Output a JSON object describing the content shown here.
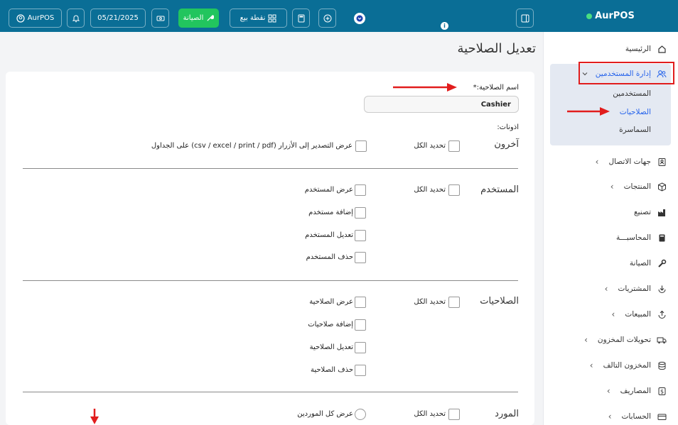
{
  "topbar": {
    "brand": "AurPOS",
    "user_label": "AurPOS",
    "date": "05/21/2025",
    "maintenance_label": "الصيانة",
    "pos_label": "نقطة بيع"
  },
  "sidebar": {
    "items": [
      {
        "label": "الرئيسية"
      },
      {
        "label": "إدارة المستخدمين"
      },
      {
        "label": "جهات الاتصال"
      },
      {
        "label": "المنتجات"
      },
      {
        "label": "تصنيع"
      },
      {
        "label": "المحاسبـــة"
      },
      {
        "label": "الصيانة"
      },
      {
        "label": "المشتريات"
      },
      {
        "label": "المبيعات"
      },
      {
        "label": "تحويلات المخزون"
      },
      {
        "label": "المخزون التالف"
      },
      {
        "label": "المصاريف"
      },
      {
        "label": "الحسابات"
      }
    ],
    "sub_items": [
      {
        "label": "المستخدمين"
      },
      {
        "label": "الصلاحيات"
      },
      {
        "label": "السماسرة"
      }
    ]
  },
  "main": {
    "title": "تعديل الصلاحية",
    "role_name_label": "اسم الصلاحية:*",
    "role_name_value": "Cashier",
    "permissions_label": "اذونات:",
    "select_all": "تحديد الكل",
    "sections": {
      "others": {
        "title": "آخرون",
        "items": [
          "عرض التصدير إلى الأزرار (csv / excel / print / pdf) على الجداول"
        ]
      },
      "user": {
        "title": "المستخدم",
        "items": [
          "عرض المستخدم",
          "إضافة مستخدم",
          "تعديل المستخدم",
          "حذف المستخدم"
        ]
      },
      "roles": {
        "title": "الصلاحيات",
        "items": [
          "عرض الصلاحية",
          "إضافة صلاحيات",
          "تعديل الصلاحية",
          "حذف الصلاحية"
        ]
      },
      "supplier": {
        "title": "المورد",
        "items": [
          "عرض كل الموردين"
        ]
      }
    }
  },
  "colors": {
    "topbar": "#0a6e96",
    "accent": "#22c55e",
    "annotation": "#e11d1d",
    "active_link": "#2563eb"
  }
}
